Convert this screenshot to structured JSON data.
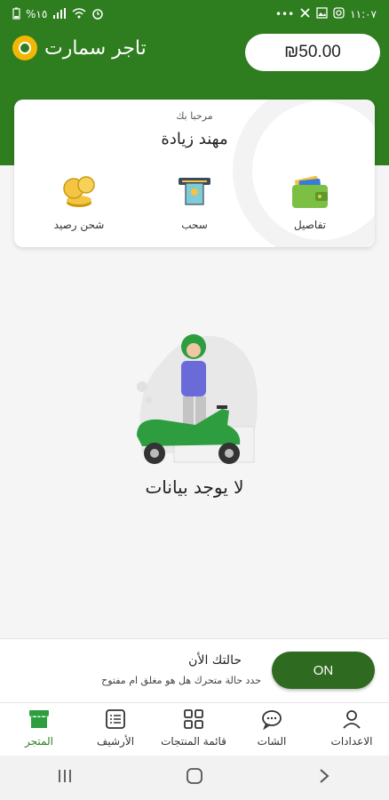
{
  "status_bar": {
    "time": "١١:٠٧",
    "battery": "%١٥",
    "icons_left": [
      "battery-icon",
      "signal-icon",
      "wifi-icon",
      "alarm-icon"
    ],
    "icons_right": [
      "more-icon",
      "settings-icon",
      "image-icon",
      "instagram-icon"
    ]
  },
  "header": {
    "app_name": "تاجر سمارت",
    "balance": "₪50.00",
    "accent_color": "#2e7d1f"
  },
  "welcome": {
    "greeting": "مرحبا بك",
    "user_name": "مهند زيادة",
    "actions": {
      "details": "تفاصيل",
      "withdraw": "سحب",
      "recharge": "شحن رصيد"
    }
  },
  "empty_state": {
    "message": "لا يوجد بيانات"
  },
  "status_section": {
    "title": "حالتك الأن",
    "description": "حدد حالة متحرك هل هو مغلق ام مفتوح",
    "toggle_label": "ON"
  },
  "bottom_nav": {
    "settings": "الاعدادات",
    "chat": "الشات",
    "products": "قائمة المنتجات",
    "archive": "الأرشيف",
    "store": "المتجر"
  }
}
